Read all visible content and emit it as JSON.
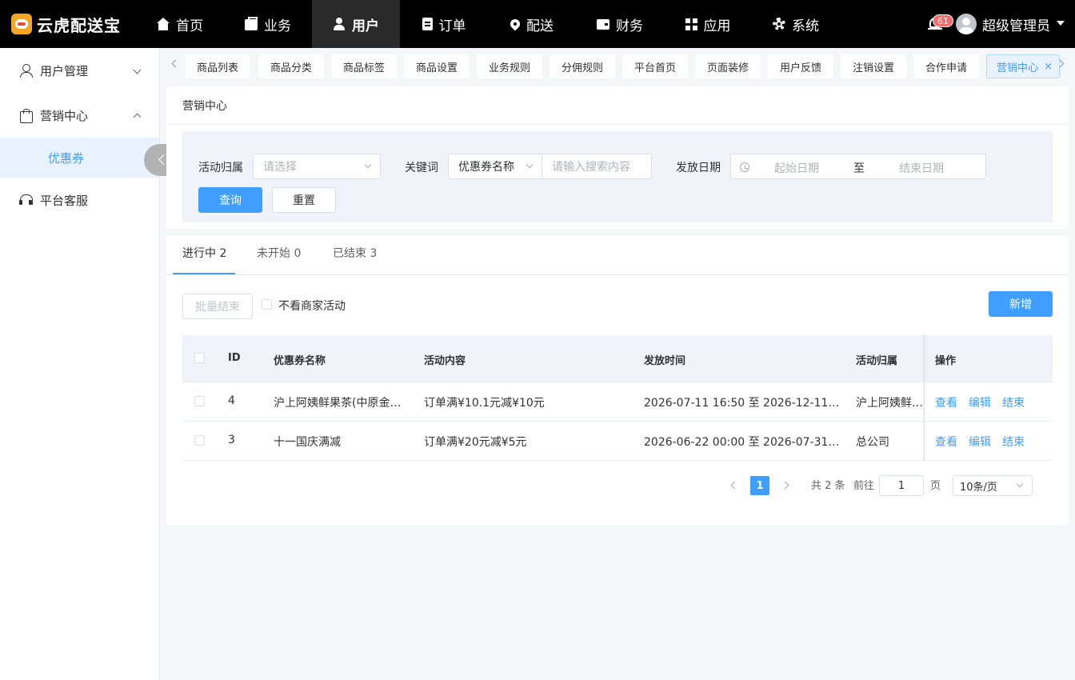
{
  "app": {
    "logo_text": "云虎配送宝"
  },
  "nav": {
    "items": [
      {
        "label": "首页",
        "icon": "home-icon"
      },
      {
        "label": "业务",
        "icon": "briefcase-icon"
      },
      {
        "label": "用户",
        "icon": "user-icon",
        "active": true
      },
      {
        "label": "订单",
        "icon": "document-icon"
      },
      {
        "label": "配送",
        "icon": "location-pin-icon"
      },
      {
        "label": "财务",
        "icon": "wallet-icon"
      },
      {
        "label": "应用",
        "icon": "apps-grid-icon"
      },
      {
        "label": "系统",
        "icon": "gear-icon"
      }
    ],
    "notification_count": "61",
    "admin_name": "超级管理员"
  },
  "sidebar": {
    "items": [
      {
        "label": "用户管理",
        "icon": "user-outline-icon",
        "expanded": false
      },
      {
        "label": "营销中心",
        "icon": "shopping-bag-icon",
        "expanded": true
      },
      {
        "label": "平台客服",
        "icon": "headset-icon"
      }
    ],
    "sub_active": "优惠券"
  },
  "tabs": {
    "items": [
      "商品列表",
      "商品分类",
      "商品标签",
      "商品设置",
      "业务规则",
      "分佣规则",
      "平台首页",
      "页面装修",
      "用户反馈",
      "注销设置",
      "合作申请"
    ],
    "active": "营销中心",
    "close_glyph": "×"
  },
  "page": {
    "title": "营销中心"
  },
  "filter": {
    "owner_label": "活动归属",
    "owner_placeholder": "请选择",
    "keyword_label": "关键词",
    "keyword_type": "优惠券名称",
    "keyword_placeholder": "请输入搜索内容",
    "date_label": "发放日期",
    "start_placeholder": "起始日期",
    "range_sep": "至",
    "end_placeholder": "结束日期",
    "search_btn": "查询",
    "reset_btn": "重置"
  },
  "status_tabs": [
    {
      "label": "进行中 2",
      "active": true
    },
    {
      "label": "未开始 0"
    },
    {
      "label": "已结束 3"
    }
  ],
  "toolbar": {
    "batch_end": "批量结束",
    "hide_merchant": "不看商家活动",
    "add": "新增"
  },
  "table": {
    "columns": [
      "ID",
      "优惠券名称",
      "活动内容",
      "发放时间",
      "活动归属",
      "操作"
    ],
    "rows": [
      {
        "id": "4",
        "name": "沪上阿姨鲜果茶(中原金…",
        "content": "订单满¥10.1元减¥10元",
        "time": "2026-07-11 16:50 至 2026-12-11 16…",
        "owner": "沪上阿姨鲜…"
      },
      {
        "id": "3",
        "name": "十一国庆满减",
        "content": "订单满¥20元减¥5元",
        "time": "2026-06-22 00:00 至 2026-07-31 00…",
        "owner": "总公司"
      }
    ],
    "actions": {
      "view": "查看",
      "edit": "编辑",
      "end": "结束"
    }
  },
  "pagination": {
    "current": "1",
    "total_text": "共 2 条",
    "goto_label": "前往",
    "goto_value": "1",
    "page_unit": "页",
    "page_size": "10条/页"
  },
  "colors": {
    "accent": "#409eff",
    "topbar": "#000000",
    "badge": "#f56c6c"
  }
}
